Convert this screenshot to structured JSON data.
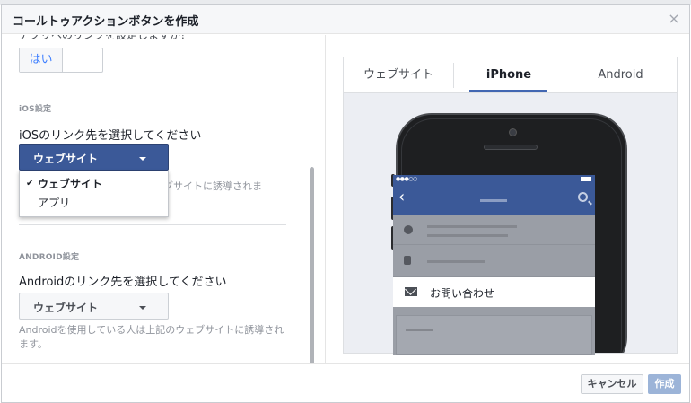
{
  "dialog": {
    "title": "コールトゥアクションボタンを作成",
    "close_icon": "close-icon"
  },
  "left": {
    "cut_question": "アプリへのリンクを設定しますか？",
    "toggle": {
      "on_label": "はい",
      "off_label": ""
    },
    "ios": {
      "section_label": "iOS設定",
      "question": "iOSのリンク先を選択してください",
      "selected": "ウェブサイト",
      "options": [
        "ウェブサイト",
        "アプリ"
      ],
      "help_visible": "ブサイトに誘導されま"
    },
    "android": {
      "section_label": "ANDROID設定",
      "question": "Androidのリンク先を選択してください",
      "selected": "ウェブサイト",
      "help": "Androidを使用している人は上記のウェブサイトに誘導されます。"
    }
  },
  "preview": {
    "tabs": [
      "ウェブサイト",
      "iPhone",
      "Android"
    ],
    "active_tab": "iPhone",
    "phone_screen": {
      "contact_label": "お問い合わせ"
    }
  },
  "footer": {
    "cancel_label": "キャンセル",
    "create_label": "作成"
  },
  "colors": {
    "facebook_blue": "#3b5998",
    "accent_blue": "#4267b2",
    "link_blue": "#4080ff",
    "disabled_button": "#9cb4d8"
  }
}
